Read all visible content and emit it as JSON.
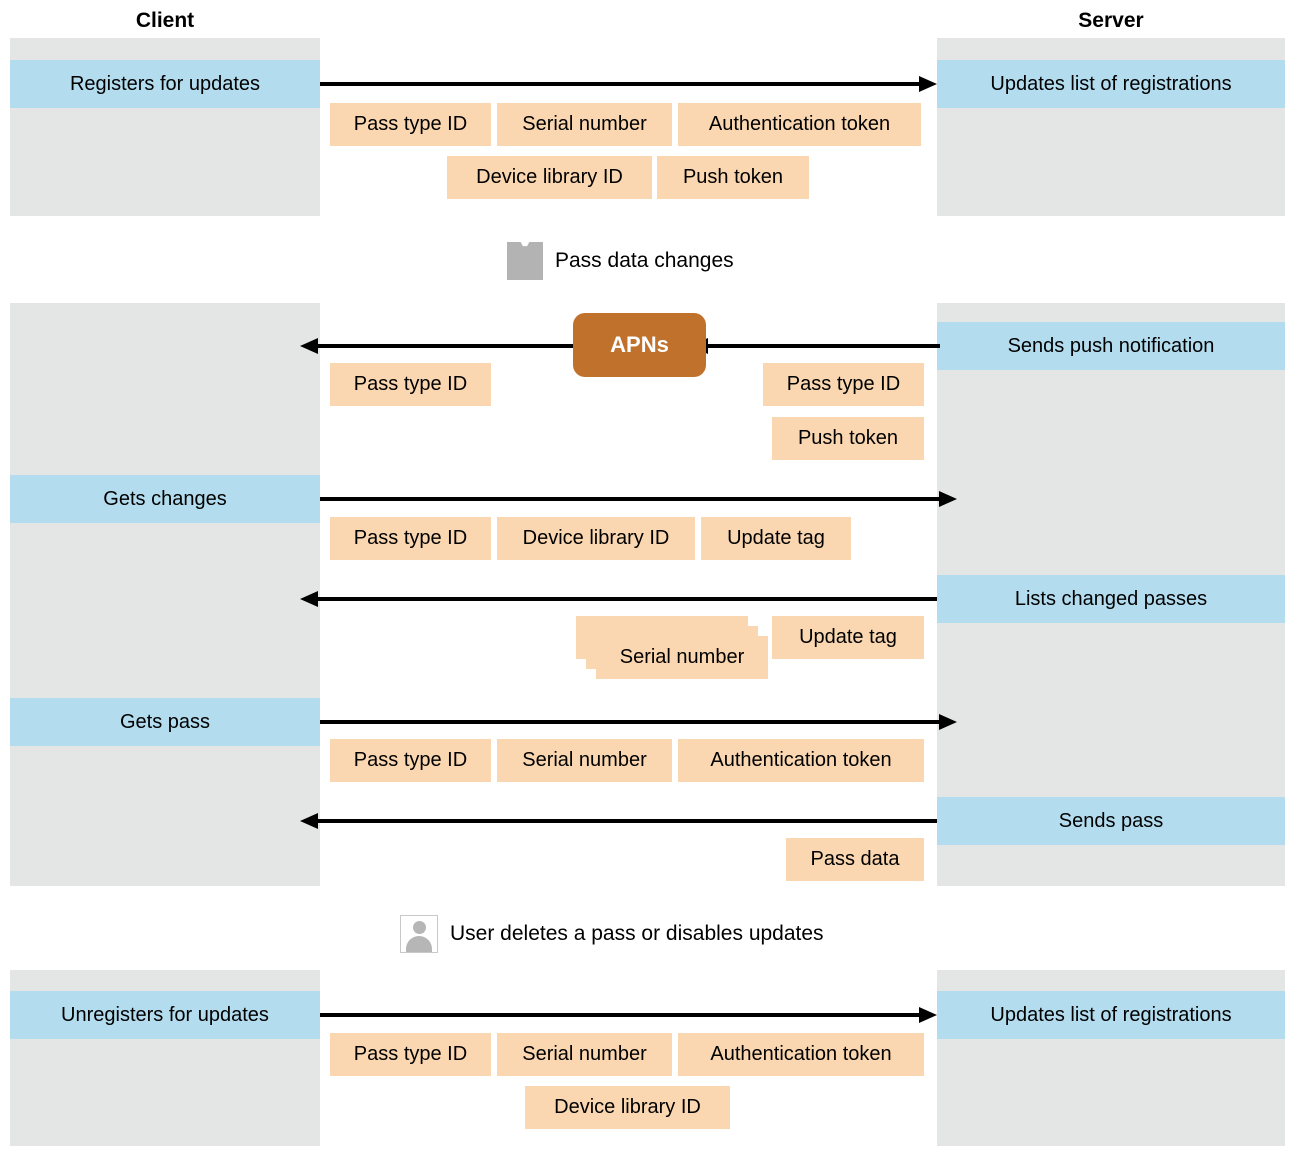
{
  "columns": {
    "client_title": "Client",
    "server_title": "Server"
  },
  "colors": {
    "lane_gray": "#e4e6e6",
    "band_blue": "#b3ddef",
    "tag_orange": "#fad7b0",
    "apns_brown": "#c0712b",
    "glyph_gray": "#b3b3b3"
  },
  "section1": {
    "client_action": "Registers for updates",
    "server_action": "Updates list of registrations",
    "payload_row1": [
      "Pass type ID",
      "Serial number",
      "Authentication token"
    ],
    "payload_row2": [
      "Device library ID",
      "Push token"
    ]
  },
  "event1": {
    "icon": "pass-icon",
    "label": "Pass data changes"
  },
  "section2": {
    "apns_label": "APNs",
    "server_push_action": "Sends push notification",
    "server_push_payload": [
      "Pass type ID",
      "Push token"
    ],
    "client_push_payload": [
      "Pass type ID"
    ],
    "client_get_changes_action": "Gets changes",
    "get_changes_payload": [
      "Pass type ID",
      "Device library ID",
      "Update tag"
    ],
    "server_list_action": "Lists changed passes",
    "list_payload_stacked": "Serial number",
    "list_payload_tag": "Update tag",
    "client_get_pass_action": "Gets pass",
    "get_pass_payload": [
      "Pass type ID",
      "Serial number",
      "Authentication token"
    ],
    "server_send_pass_action": "Sends pass",
    "send_pass_payload": [
      "Pass data"
    ]
  },
  "event2": {
    "icon": "user-icon",
    "label": "User deletes a pass or disables updates"
  },
  "section3": {
    "client_action": "Unregisters for updates",
    "server_action": "Updates list of registrations",
    "payload_row1": [
      "Pass type ID",
      "Serial number",
      "Authentication token"
    ],
    "payload_row2": [
      "Device library ID"
    ]
  }
}
